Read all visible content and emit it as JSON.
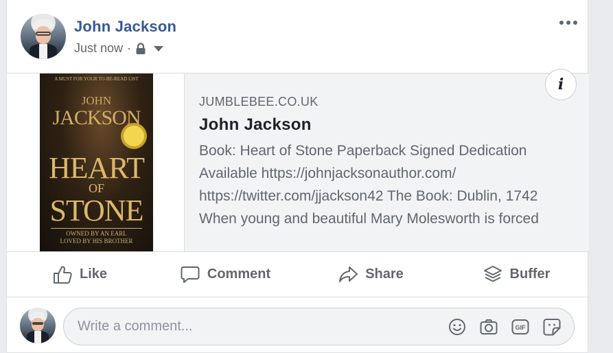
{
  "post": {
    "author": "John Jackson",
    "timestamp": "Just now",
    "separator": "·",
    "privacy_icon": "lock-icon",
    "audience_icon": "caret-down-icon",
    "more_icon": "more-options-icon"
  },
  "preview": {
    "domain": "JUMBLEBEE.CO.UK",
    "title": "John Jackson",
    "description_lines": [
      "Book: Heart of Stone Paperback Signed Dedication",
      "Available https://johnjacksonauthor.com/",
      "https://twitter.com/jjackson42 The Book: Dublin, 1742",
      "When young and beautiful Mary Molesworth is forced"
    ],
    "info_label": "i",
    "book_cover": {
      "blurb": "A MUST FOR YOUR TO-BE-READ LIST",
      "author_first": "JOHN",
      "author_last": "JACKSON",
      "title_line1": "HEART",
      "title_of": "OF",
      "title_line2": "STONE",
      "tagline_line1": "OWNED BY AN EARL",
      "tagline_line2": "LOVED BY HIS BROTHER"
    }
  },
  "actions": {
    "like": "Like",
    "comment": "Comment",
    "share": "Share",
    "buffer": "Buffer"
  },
  "comment": {
    "placeholder": "Write a comment...",
    "tools": [
      "emoji-icon",
      "camera-icon",
      "gif-icon",
      "sticker-icon"
    ]
  },
  "colors": {
    "author_link": "#365899",
    "secondary_text": "#606770",
    "preview_bg": "#f2f3f5",
    "border": "#dadde1"
  }
}
